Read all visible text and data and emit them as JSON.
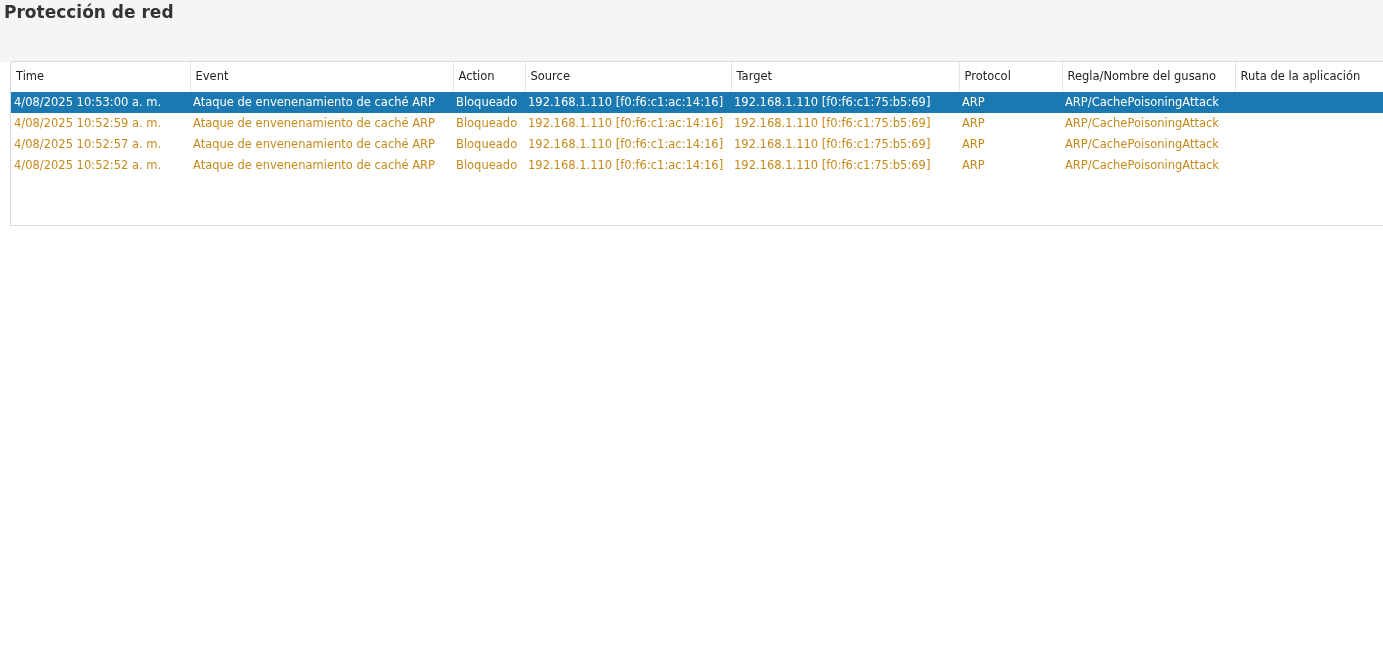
{
  "page_title": "Protección de red",
  "table": {
    "columns": [
      "Time",
      "Event",
      "Action",
      "Source",
      "Target",
      "Protocol",
      "Regla/Nombre del gusano",
      "Ruta de la aplicación"
    ],
    "rows": [
      {
        "selected": true,
        "cells": [
          "4/08/2025 10:53:00 a. m.",
          "Ataque de envenenamiento de caché ARP",
          "Bloqueado",
          "192.168.1.110 [f0:f6:c1:ac:14:16]",
          "192.168.1.110 [f0:f6:c1:75:b5:69]",
          "ARP",
          "ARP/CachePoisoningAttack"
        ]
      },
      {
        "selected": false,
        "cells": [
          "4/08/2025 10:52:59 a. m.",
          "Ataque de envenenamiento de caché ARP",
          "Bloqueado",
          "192.168.1.110 [f0:f6:c1:ac:14:16]",
          "192.168.1.110 [f0:f6:c1:75:b5:69]",
          "ARP",
          "ARP/CachePoisoningAttack"
        ]
      },
      {
        "selected": false,
        "cells": [
          "4/08/2025 10:52:57 a. m.",
          "Ataque de envenenamiento de caché ARP",
          "Bloqueado",
          "192.168.1.110 [f0:f6:c1:ac:14:16]",
          "192.168.1.110 [f0:f6:c1:75:b5:69]",
          "ARP",
          "ARP/CachePoisoningAttack"
        ]
      },
      {
        "selected": false,
        "cells": [
          "4/08/2025 10:52:52 a. m.",
          "Ataque de envenenamiento de caché ARP",
          "Bloqueado",
          "192.168.1.110 [f0:f6:c1:ac:14:16]",
          "192.168.1.110 [f0:f6:c1:75:b5:69]",
          "ARP",
          "ARP/CachePoisoningAttack"
        ]
      }
    ]
  }
}
